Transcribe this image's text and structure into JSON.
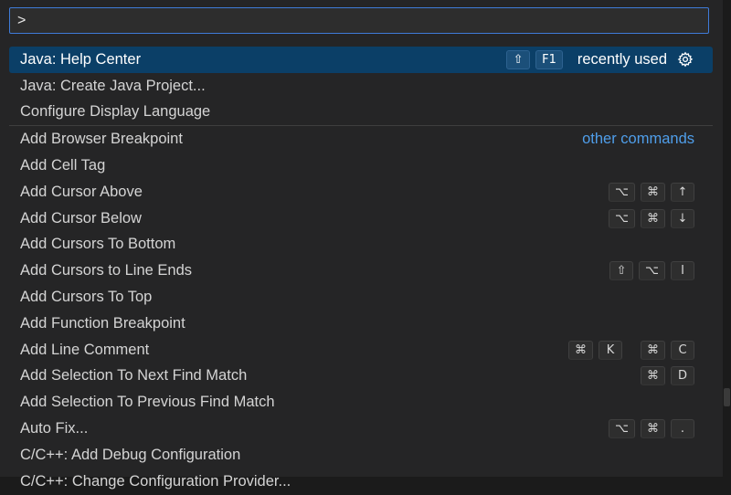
{
  "input": {
    "value": ">",
    "placeholder": ""
  },
  "colors": {
    "accent": "#3f7bd8",
    "selected_bg": "#0b3f67",
    "link": "#4f9eea"
  },
  "top_group": [
    {
      "label": "Java: Help Center",
      "keys": [
        "⇧",
        "F1"
      ],
      "description": "recently used",
      "icon": "gear-icon",
      "selected": true
    },
    {
      "label": "Java: Create Java Project..."
    },
    {
      "label": "Configure Display Language"
    }
  ],
  "other_group_label": "other commands",
  "commands": [
    {
      "label": "Add Browser Breakpoint"
    },
    {
      "label": "Add Cell Tag"
    },
    {
      "label": "Add Cursor Above",
      "keys": [
        "⌥",
        "⌘",
        "↑"
      ]
    },
    {
      "label": "Add Cursor Below",
      "keys": [
        "⌥",
        "⌘",
        "↓"
      ]
    },
    {
      "label": "Add Cursors To Bottom"
    },
    {
      "label": "Add Cursors to Line Ends",
      "keys": [
        "⇧",
        "⌥",
        "I"
      ]
    },
    {
      "label": "Add Cursors To Top"
    },
    {
      "label": "Add Function Breakpoint"
    },
    {
      "label": "Add Line Comment",
      "keys": [
        "⌘",
        "K"
      ],
      "keys2": [
        "⌘",
        "C"
      ]
    },
    {
      "label": "Add Selection To Next Find Match",
      "keys": [
        "⌘",
        "D"
      ]
    },
    {
      "label": "Add Selection To Previous Find Match"
    },
    {
      "label": "Auto Fix...",
      "keys": [
        "⌥",
        "⌘",
        "."
      ]
    },
    {
      "label": "C/C++: Add Debug Configuration"
    },
    {
      "label": "C/C++: Change Configuration Provider..."
    }
  ]
}
